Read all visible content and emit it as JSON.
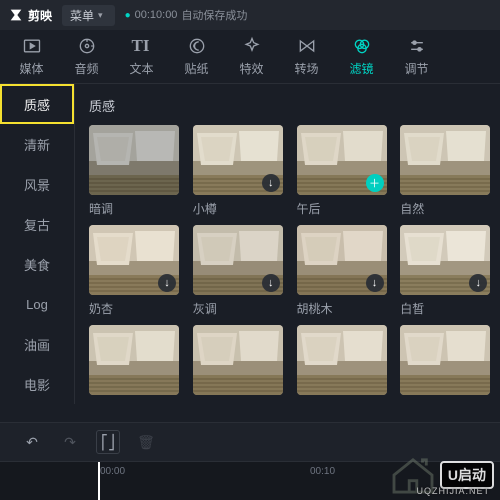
{
  "app": {
    "name": "剪映",
    "menu_label": "菜单"
  },
  "autosave": {
    "time": "00:10:00",
    "status": "自动保存成功"
  },
  "toolbar": [
    {
      "id": "media",
      "label": "媒体",
      "icon": "play-box"
    },
    {
      "id": "audio",
      "label": "音频",
      "icon": "disc"
    },
    {
      "id": "text",
      "label": "文本",
      "icon": "text"
    },
    {
      "id": "sticker",
      "label": "贴纸",
      "icon": "moon"
    },
    {
      "id": "effect",
      "label": "特效",
      "icon": "sparkle"
    },
    {
      "id": "transition",
      "label": "转场",
      "icon": "bowtie"
    },
    {
      "id": "filter",
      "label": "滤镜",
      "icon": "venn",
      "active": true
    },
    {
      "id": "adjust",
      "label": "调节",
      "icon": "sliders"
    }
  ],
  "sidebar": [
    {
      "id": "texture",
      "label": "质感",
      "highlighted": true
    },
    {
      "id": "fresh",
      "label": "清新"
    },
    {
      "id": "scenery",
      "label": "风景"
    },
    {
      "id": "retro",
      "label": "复古"
    },
    {
      "id": "food",
      "label": "美食"
    },
    {
      "id": "log",
      "label": "Log"
    },
    {
      "id": "oil",
      "label": "油画"
    },
    {
      "id": "movie",
      "label": "电影"
    }
  ],
  "section_title": "质感",
  "filters": [
    {
      "label": "暗调",
      "tint": "#4b5768",
      "btn": "none"
    },
    {
      "label": "小樽",
      "tint": "#d9d3c4",
      "btn": "gray"
    },
    {
      "label": "午后",
      "tint": "#cfc6b4",
      "btn": "teal"
    },
    {
      "label": "自然",
      "tint": "#d6d0c2",
      "btn": "none"
    },
    {
      "label": "奶杏",
      "tint": "#e2d3c3",
      "btn": "gray"
    },
    {
      "label": "灰调",
      "tint": "#b7afa2",
      "btn": "gray"
    },
    {
      "label": "胡桃木",
      "tint": "#c9b8a4",
      "btn": "gray"
    },
    {
      "label": "白皙",
      "tint": "#e8e3d8",
      "btn": "gray"
    },
    {
      "label": "",
      "tint": "#d0c8b8",
      "btn": "none"
    },
    {
      "label": "",
      "tint": "#cbc0ae",
      "btn": "none"
    },
    {
      "label": "",
      "tint": "#d5ccbc",
      "btn": "none"
    },
    {
      "label": "",
      "tint": "#d5ccbc",
      "btn": "none"
    }
  ],
  "timeline": {
    "ticks": [
      "00:00",
      "00:10"
    ]
  },
  "watermark": {
    "text": "U启动",
    "sub": "UQZHIJIA.NET"
  },
  "colors": {
    "accent": "#00d4c4",
    "highlight": "#f5e030"
  }
}
